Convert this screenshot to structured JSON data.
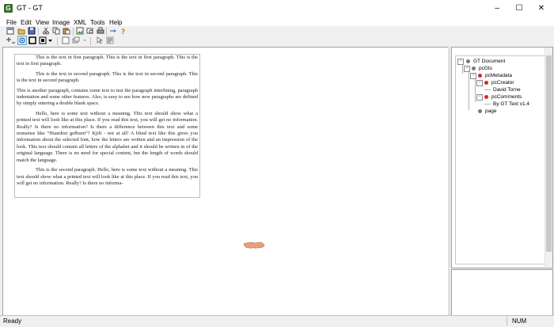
{
  "window": {
    "title": "GT - GT",
    "app_icon_letter": "G",
    "minimize": "–",
    "maximize": "☐",
    "close": "✕"
  },
  "menu": [
    "File",
    "Edit",
    "View",
    "Image",
    "XML",
    "Tools",
    "Help"
  ],
  "document": {
    "paragraphs": [
      "This is the text in first paragraph. This is the text in first paragraph. This is the text in first paragraph.",
      "This is the text in second paragraph. This is the text in second paragraph. This is the text in second paragraph.",
      "This is another paragraph, contains some text to test the paragraph interlining, paragraph indentation and some other features. Also, is easy to see how new paragraphs are defined by simply entering a double blank space.",
      "Hello, here is some text without a meaning. This text should show what a printed text will look like at this place. If you read this text, you will get no information. Really? Is there no information? Is there a difference between this text and some nonsense like “Huardest gefburn”? Kjift - not at all! A blind text like this gives you information about the selected font, how the letters are written and an impression of the look. This text should contain all letters of the alphabet and it should be written in of the original language. There is no need for special content, but the length of words should match the language.",
      "This is the second paragraph. Hello, here is some text without a meaning. This text should show what a printed text will look like at this place. If you read this text, you will get no information. Really? Is there no informa-"
    ]
  },
  "tree": {
    "root": "GT Document",
    "pcgts": "pcGts",
    "metadata": "pcMetadata",
    "creator": "pcCreator",
    "creator_value": "David Torne",
    "comments": "pcComments",
    "comments_value": "By GT Text v1.4",
    "page": "page",
    "expand_symbol": "−"
  },
  "status": {
    "text": "Ready",
    "num": "NUM"
  }
}
